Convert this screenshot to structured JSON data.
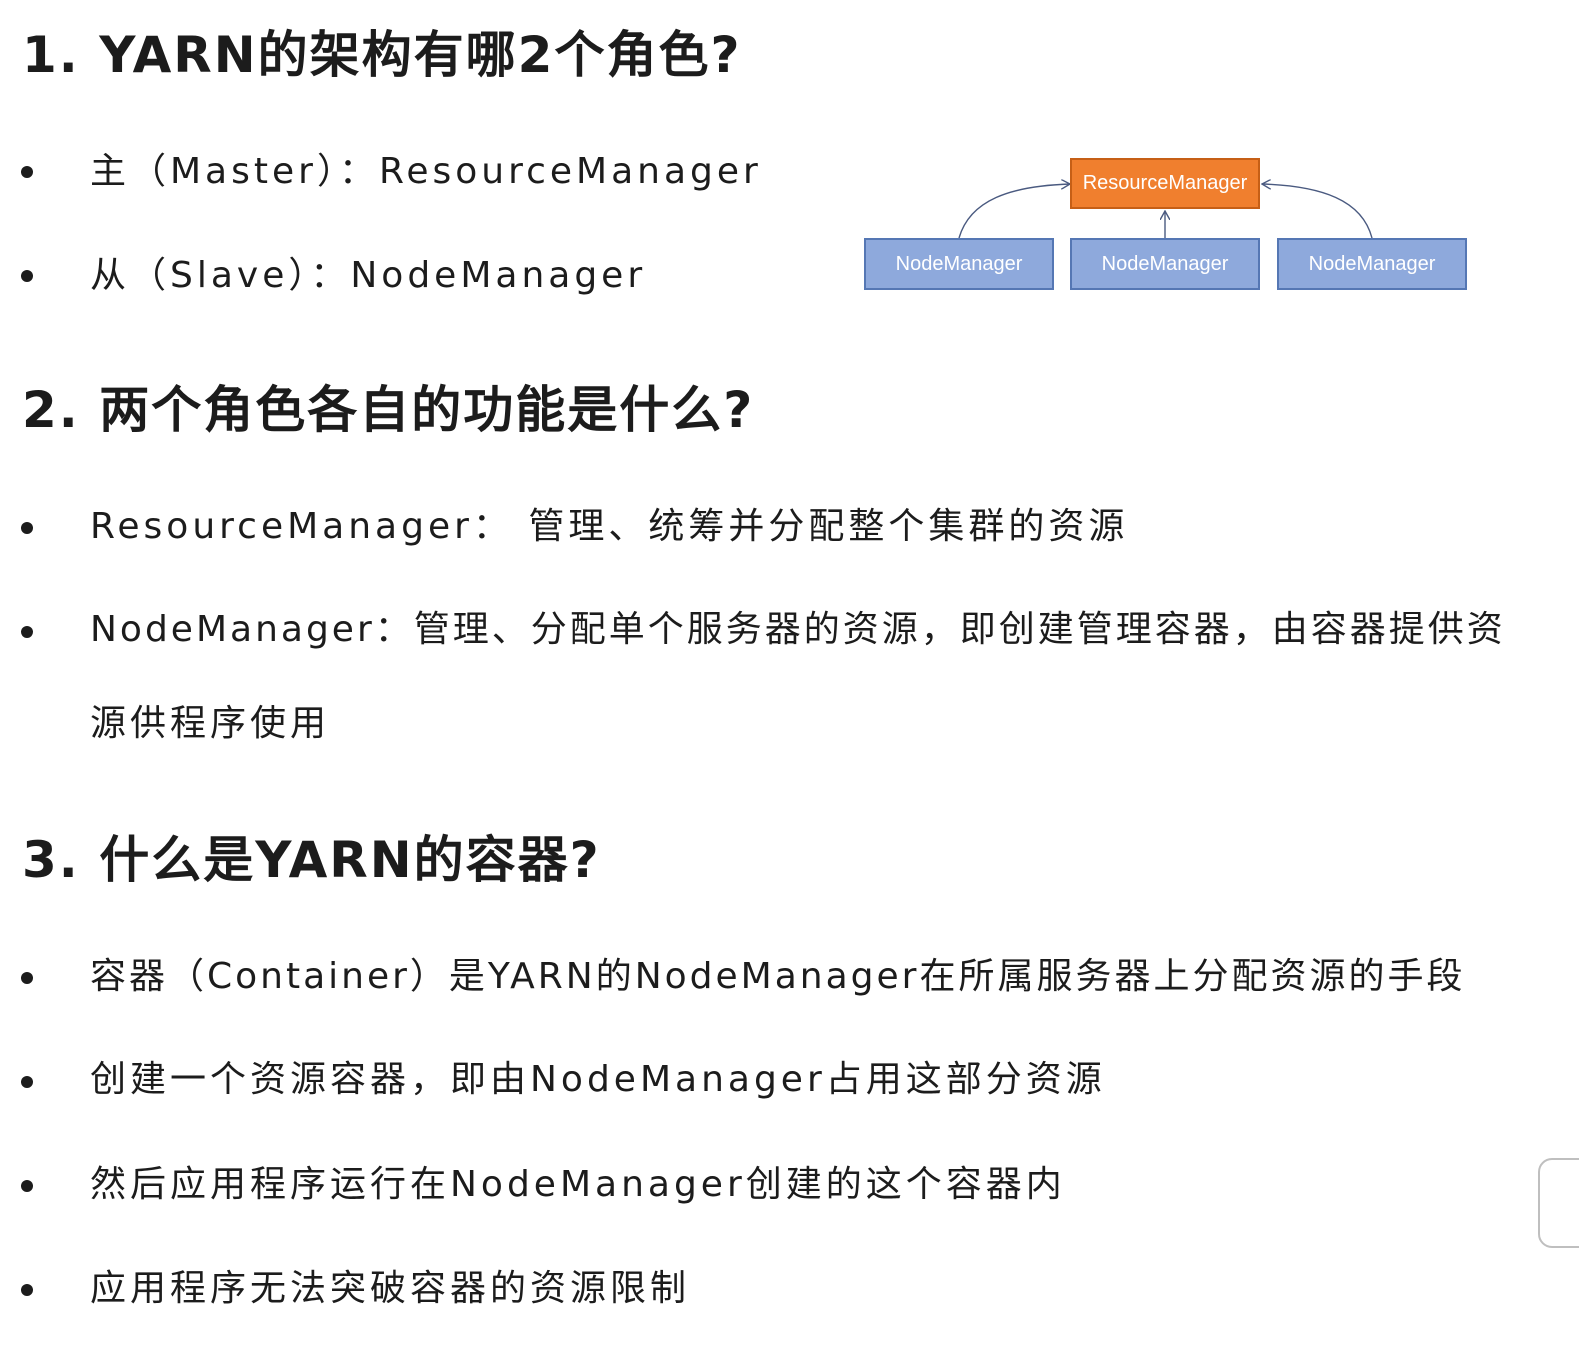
{
  "section1": {
    "heading": "1. YARN的架构有哪2个角色?",
    "bullets": [
      "主（Master）：ResourceManager",
      "从（Slave）：NodeManager"
    ]
  },
  "diagram": {
    "master": "ResourceManager",
    "workers": [
      "NodeManager",
      "NodeManager",
      "NodeManager"
    ],
    "colors": {
      "master_fill": "#f07f2e",
      "worker_fill": "#8ea9dc",
      "arrow": "#4a5a80"
    }
  },
  "section2": {
    "heading": "2. 两个角色各自的功能是什么?",
    "bullets": [
      "ResourceManager： 管理、统筹并分配整个集群的资源",
      "NodeManager：管理、分配单个服务器的资源，即创建管理容器，由容器提供资",
      "源供程序使用"
    ]
  },
  "section3": {
    "heading": "3. 什么是YARN的容器?",
    "bullets": [
      "容器（Container）是YARN的NodeManager在所属服务器上分配资源的手段",
      "创建一个资源容器，即由NodeManager占用这部分资源",
      "然后应用程序运行在NodeManager创建的这个容器内",
      "应用程序无法突破容器的资源限制"
    ]
  }
}
